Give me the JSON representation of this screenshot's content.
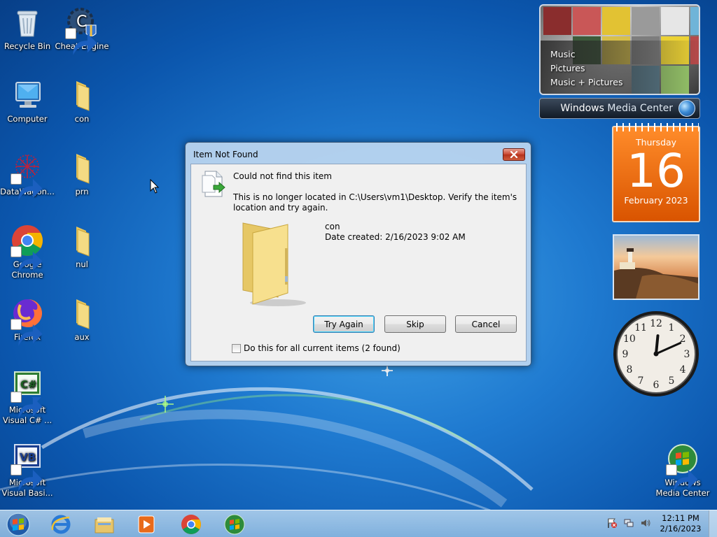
{
  "desktop": {
    "icons": [
      {
        "label": "Recycle Bin"
      },
      {
        "label": "Cheat Engine"
      },
      {
        "label": "Computer"
      },
      {
        "label": "con"
      },
      {
        "label": "DataWagon..."
      },
      {
        "label": "prn"
      },
      {
        "label": "Google Chrome"
      },
      {
        "label": "nul"
      },
      {
        "label": "Firefox"
      },
      {
        "label": "aux"
      },
      {
        "label": "Microsoft Visual C# ..."
      },
      {
        "label": "Microsoft Visual Basi..."
      },
      {
        "label": "Windows Media Center"
      }
    ]
  },
  "gadgets": {
    "media_center": {
      "menu": [
        "Music",
        "Pictures",
        "Music + Pictures"
      ],
      "brand_a": "Windows",
      "brand_b": "Media Center"
    },
    "calendar": {
      "weekday": "Thursday",
      "day": "16",
      "month_year": "February 2023"
    }
  },
  "dialog": {
    "title": "Item Not Found",
    "heading": "Could not find this item",
    "detail": "This is no longer located in C:\\Users\\vm1\\Desktop. Verify the item's location and try again.",
    "item_name": "con",
    "item_date": "Date created: 2/16/2023 9:02 AM",
    "buttons": {
      "try_again": "Try Again",
      "skip": "Skip",
      "cancel": "Cancel"
    },
    "checkbox_label": "Do this for all current items (2 found)",
    "checkbox_checked": false
  },
  "taskbar": {
    "apps": [
      "internet-explorer",
      "windows-explorer",
      "media-player",
      "google-chrome",
      "windows-media-center"
    ],
    "time": "12:11 PM",
    "date": "2/16/2023"
  },
  "colors": {
    "calendar_orange": "#e8680c",
    "accent_blue": "#1f7ad0",
    "close_red": "#c9442f"
  }
}
